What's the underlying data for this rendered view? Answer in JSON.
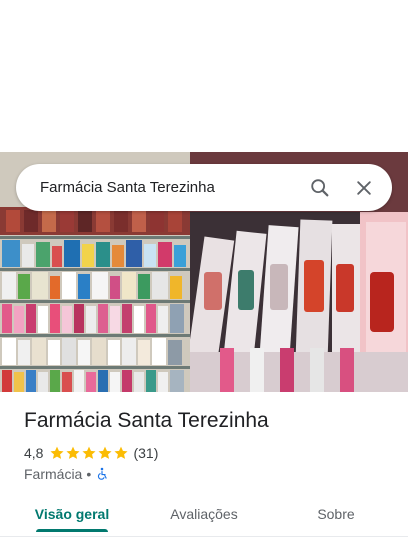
{
  "search": {
    "query": "Farmácia Santa Terezinha"
  },
  "place": {
    "name": "Farmácia Santa Terezinha",
    "rating": "4,8",
    "stars": 5,
    "review_count": "(31)",
    "category": "Farmácia",
    "separator": "•"
  },
  "tabs": [
    {
      "label": "Visão geral",
      "selected": true
    },
    {
      "label": "Avaliações",
      "selected": false
    },
    {
      "label": "Sobre",
      "selected": false
    }
  ],
  "colors": {
    "accent": "#01796f",
    "star": "#fbbc04",
    "accessibility": "#1a73e8"
  },
  "icons": [
    "search-icon",
    "close-icon",
    "star-icon",
    "wheelchair-icon"
  ]
}
